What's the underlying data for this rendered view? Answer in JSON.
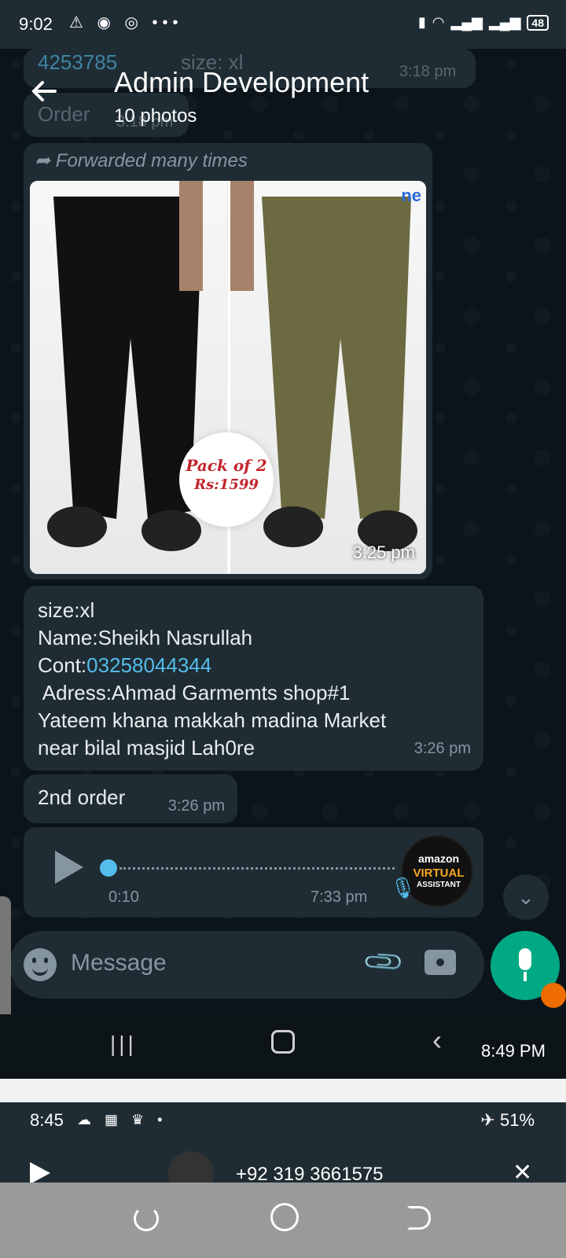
{
  "status_bar": {
    "time": "9:02",
    "left_icons": "⚠ ◉ ◎ •••",
    "battery": "48"
  },
  "header": {
    "title": "Admin Development",
    "subtitle": "10 photos"
  },
  "ghost_rows": {
    "number": "4253785",
    "size": "size: xl",
    "time": "3:18 pm",
    "order": "Order",
    "order_time": "3:18 pm"
  },
  "photo_message": {
    "forwarded_label": "Forwarded many times",
    "badge_line1": "Pack of 2",
    "badge_line2": "Rs:1599",
    "brand_fragment": "ne",
    "time": "3:25 pm"
  },
  "order_message": {
    "line1": "size:xl",
    "line2": "Name:Sheikh Nasrullah",
    "cont_label": "Cont:",
    "cont_number": "03258044344",
    "line4": " Adress:Ahmad Garmemts shop#1",
    "line5": "Yateem khana makkah madina Market",
    "line6": "near bilal masjid Lah0re",
    "time": "3:26 pm"
  },
  "second_order": {
    "text": "2nd order",
    "time": "3:26 pm"
  },
  "voice_note": {
    "duration": "0:10",
    "time": "7:33 pm",
    "progress": 0,
    "avatar_line1": "amazon",
    "avatar_line2": "VIRTUAL",
    "avatar_line3": "ASSISTANT"
  },
  "composer": {
    "placeholder": "Message"
  },
  "nav": {
    "overlay_time": "8:49 PM"
  },
  "lower_screen": {
    "time": "8:45",
    "icons": "☁ ▦ ♛ •",
    "right": "✈ 51%",
    "number": "+92 319 3661575"
  },
  "colors": {
    "accent": "#00a884",
    "link": "#53bdeb",
    "bubble": "#1f2c33",
    "background": "#0b141a"
  }
}
